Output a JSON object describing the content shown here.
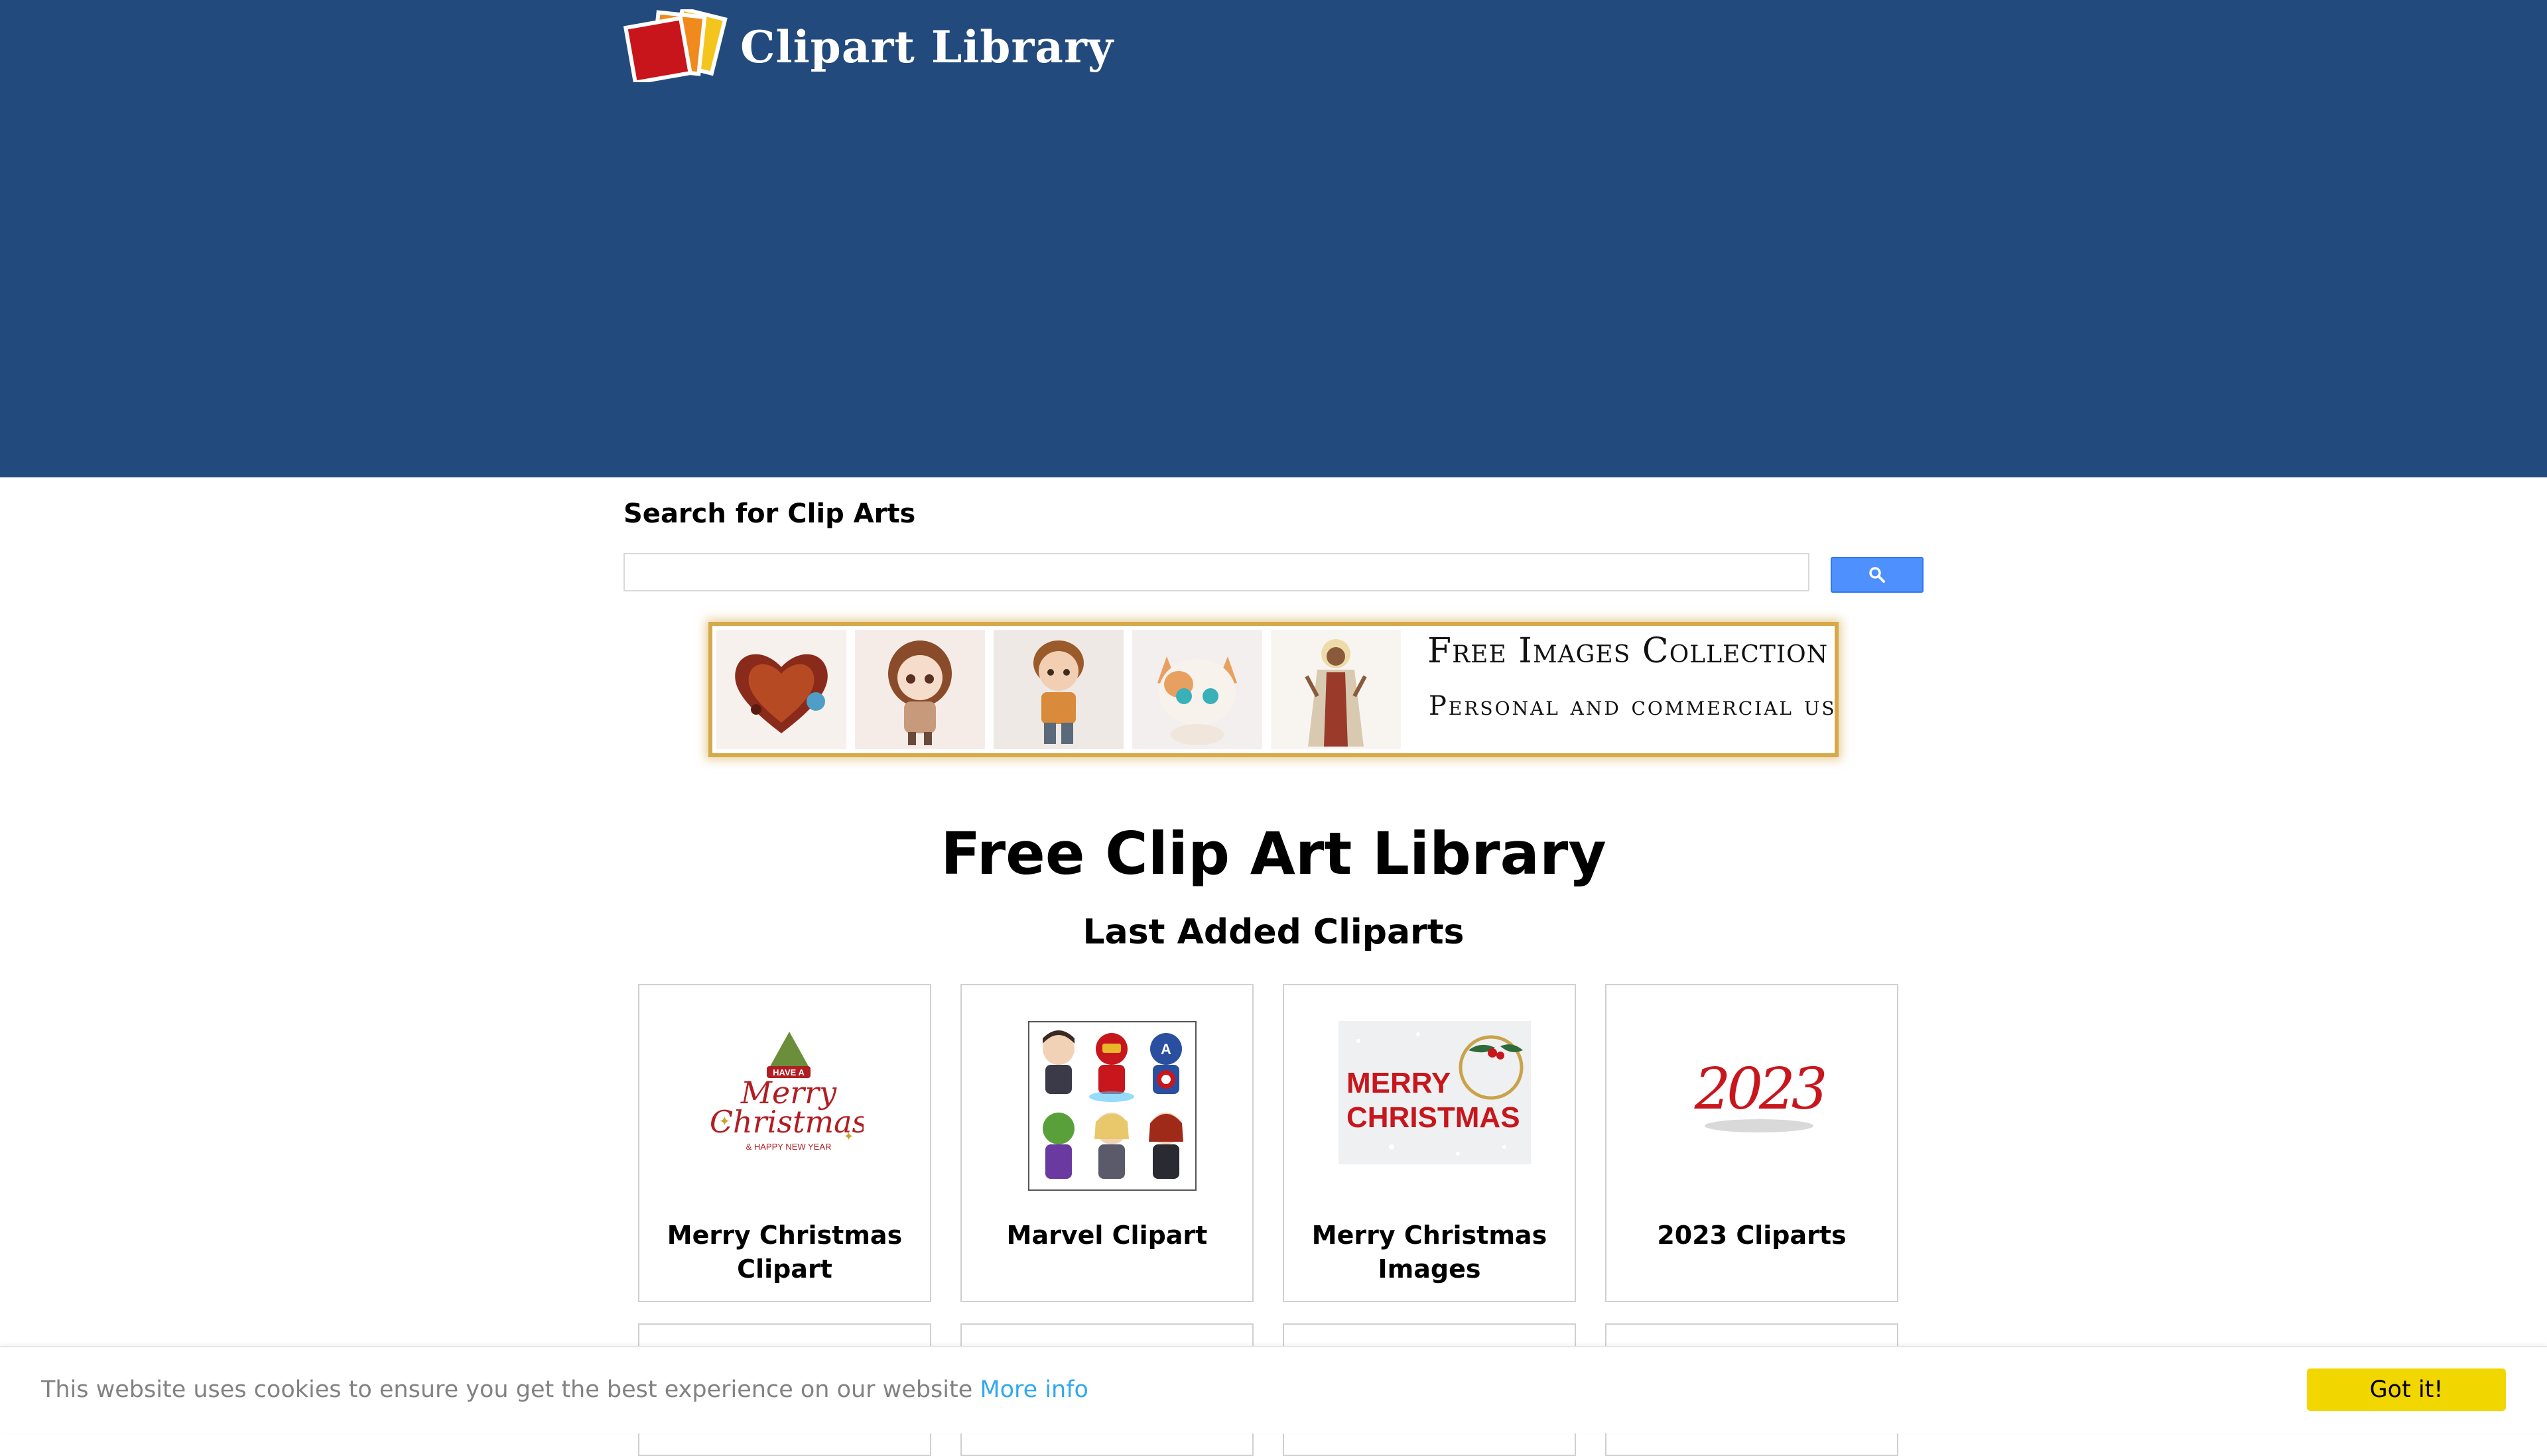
{
  "header": {
    "logo_text": "Clipart Library",
    "background_color": "#234a7c"
  },
  "search": {
    "heading": "Search for Clip Arts",
    "placeholder": "",
    "button_icon": "search-icon"
  },
  "banner": {
    "title": "Free Images Collection",
    "subtitle": "Personal and commercial use",
    "thumbnails": [
      "heart-image",
      "girl-image",
      "boy-image",
      "cat-image",
      "jesus-image"
    ]
  },
  "main": {
    "title": "Free Clip Art Library",
    "section_title": "Last Added Cliparts",
    "cards": [
      {
        "label": "Merry Christmas Clipart",
        "image_icon": "merry-christmas-text-image"
      },
      {
        "label": "Marvel Clipart",
        "image_icon": "marvel-heroes-image"
      },
      {
        "label": "Merry Christmas Images",
        "image_icon": "merry-christmas-snow-image"
      },
      {
        "label": "2023 Cliparts",
        "image_icon": "2023-image"
      }
    ],
    "christmas_art": {
      "line1": "HAVE A",
      "line2": "Merry",
      "line3": "Christmas",
      "line4": "& HAPPY NEW YEAR"
    },
    "snow_art": {
      "line1": "MERRY",
      "line2": "CHRISTMAS"
    },
    "year_art": "2023"
  },
  "cookie_bar": {
    "message": "This website uses cookies to ensure you get the best experience on our website",
    "link_text": "More info",
    "button_label": "Got it!",
    "button_color": "#f1d600",
    "link_color": "#31a8f0"
  }
}
